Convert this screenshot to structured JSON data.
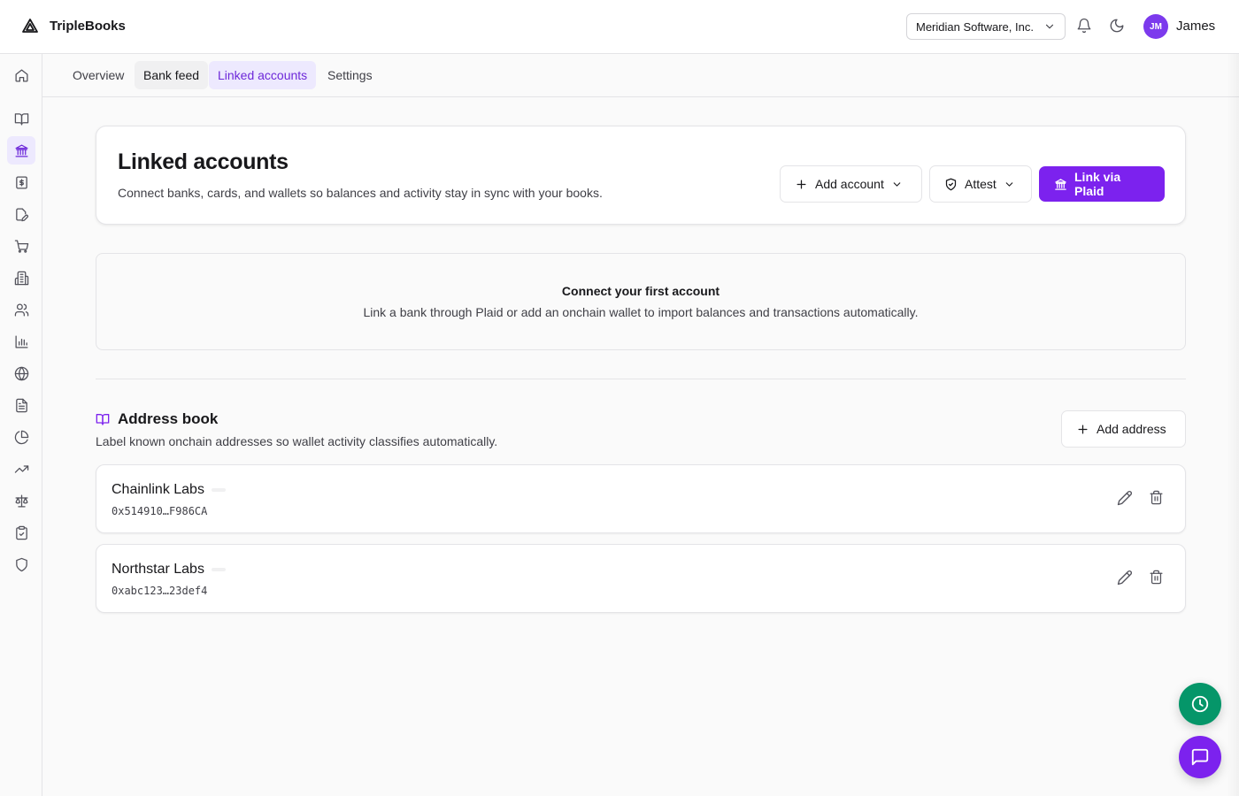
{
  "app": {
    "name": "TripleBooks"
  },
  "header": {
    "organization": "Meridian Software, Inc.",
    "user_initials": "JM",
    "user_name": "James"
  },
  "sidebar": {
    "items": [
      {
        "icon": "home-icon"
      },
      {
        "icon": "book-open-icon"
      },
      {
        "icon": "bank-icon",
        "active": true
      },
      {
        "icon": "dollar-receipt-icon"
      },
      {
        "icon": "file-edit-icon"
      },
      {
        "icon": "cart-icon"
      },
      {
        "icon": "building-icon"
      },
      {
        "icon": "users-icon"
      },
      {
        "icon": "bar-chart-icon"
      },
      {
        "icon": "globe-icon"
      },
      {
        "icon": "document-icon"
      },
      {
        "icon": "pie-chart-icon"
      },
      {
        "icon": "trending-up-icon"
      },
      {
        "icon": "scale-icon"
      },
      {
        "icon": "clipboard-check-icon"
      },
      {
        "icon": "shield-icon"
      }
    ]
  },
  "tabs": [
    {
      "label": "Overview"
    },
    {
      "label": "Bank feed"
    },
    {
      "label": "Linked accounts"
    },
    {
      "label": "Settings"
    }
  ],
  "page": {
    "title": "Linked accounts",
    "subtitle": "Connect banks, cards, and wallets so balances and activity stay in sync with your books.",
    "add_account_label": "Add account",
    "attest_label": "Attest",
    "link_plaid_label": "Link via Plaid"
  },
  "empty_state": {
    "title": "Connect your first account",
    "description": "Link a bank through Plaid or add an onchain wallet to import balances and transactions automatically."
  },
  "address_book": {
    "title": "Address book",
    "description": "Label known onchain addresses so wallet activity classifies automatically.",
    "add_label": "Add address",
    "entries": [
      {
        "name": "Chainlink Labs",
        "address": "0x514910…F986CA"
      },
      {
        "name": "Northstar Labs",
        "address": "0xabc123…23def4"
      }
    ]
  },
  "colors": {
    "accent": "#7c22ee",
    "accent_soft": "#ede9fe",
    "success": "#059669",
    "border": "#e4e4e7"
  }
}
